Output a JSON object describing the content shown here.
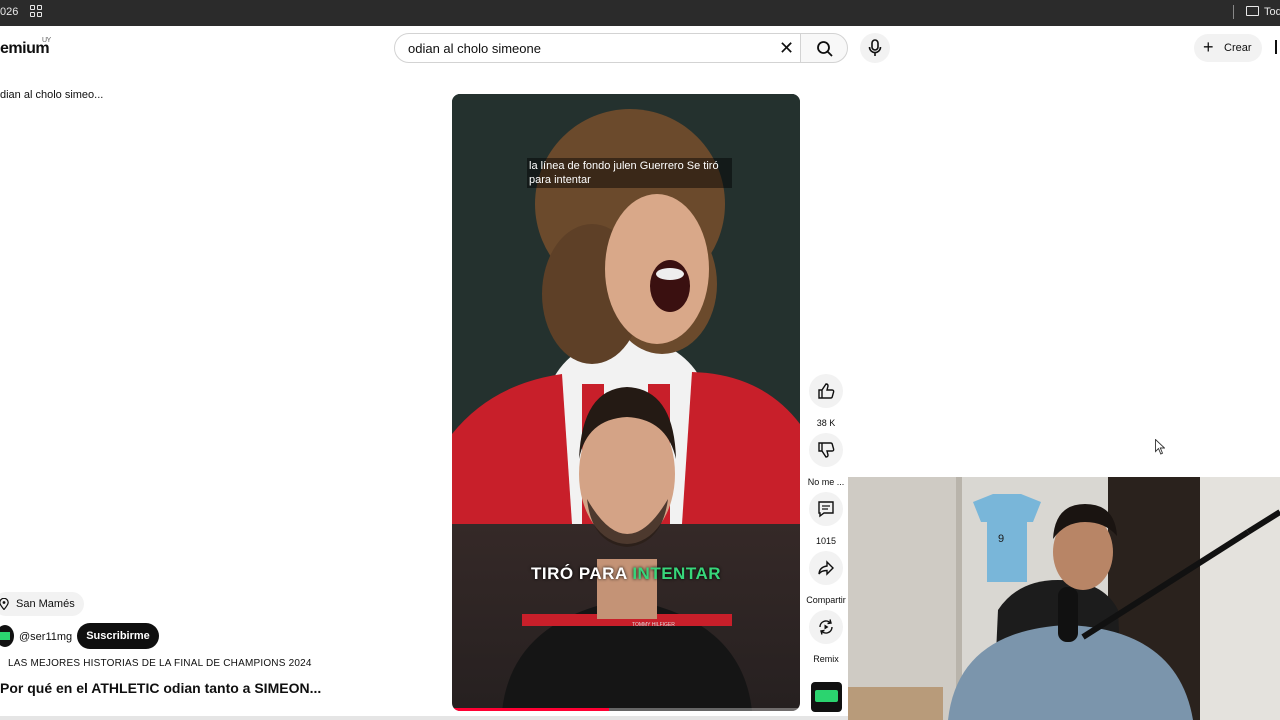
{
  "browser": {
    "year_fragment": "026",
    "bookmark_folder": "Tod"
  },
  "header": {
    "logo": "emium",
    "logo_region": "UY",
    "search": {
      "query": "odian al cholo simeone"
    },
    "create_label": "Crear"
  },
  "breadcrumb": "dian al cholo simeo...",
  "short": {
    "caption_top": "la línea de fondo julen Guerrero Se tiró para intentar",
    "caption_bottom_plain": "TIRÓ PARA ",
    "caption_bottom_highlight": "INTENTAR",
    "shirt_brand": "TOMMY HILFIGER",
    "progress_fraction": 0.45
  },
  "actions": {
    "likes": "38 K",
    "dislike_label": "No me ...",
    "comments": "1015",
    "share_label": "Compartir",
    "remix_label": "Remix"
  },
  "meta": {
    "location": "San Mamés",
    "channel_handle": "@ser11mg",
    "subscribe_label": "Suscribirme",
    "playlist": "LAS MEJORES HISTORIAS DE LA FINAL DE CHAMPIONS 2024",
    "title": "Por qué en el ATHLETIC odian tanto a SIMEON..."
  },
  "colors": {
    "accent_red": "#ff0033",
    "caption_green": "#37d67a"
  }
}
